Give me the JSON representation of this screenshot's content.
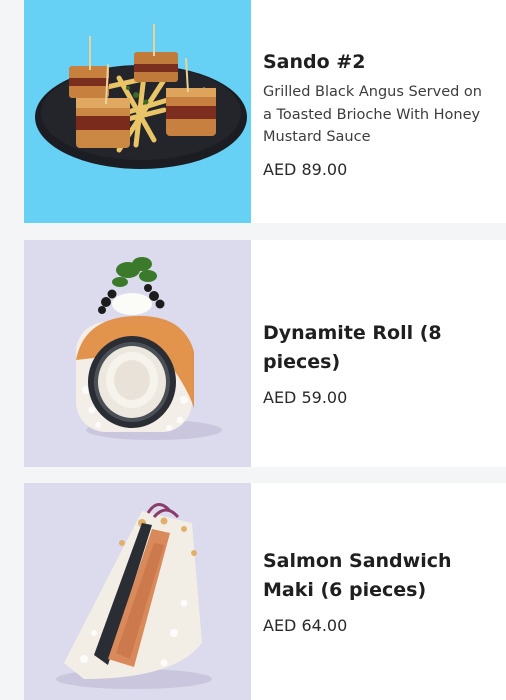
{
  "colors": {
    "page_background": "#f4f5f7",
    "card_background": "#ffffff",
    "thumb_blue": "#66d0f5",
    "thumb_lavender": "#dcdaed"
  },
  "items": [
    {
      "name": "Sando #2",
      "description": "Grilled Black Angus Served on a Toasted Brioche With Honey Mustard Sauce",
      "price": "AED 89.00",
      "image_icon": "sando-image"
    },
    {
      "name": "Dynamite Roll (8 pieces)",
      "description": "",
      "price": "AED 59.00",
      "image_icon": "dynamite-roll-image"
    },
    {
      "name": "Salmon Sandwich Maki (6 pieces)",
      "description": "",
      "price": "AED 64.00",
      "image_icon": "salmon-sandwich-maki-image"
    }
  ]
}
